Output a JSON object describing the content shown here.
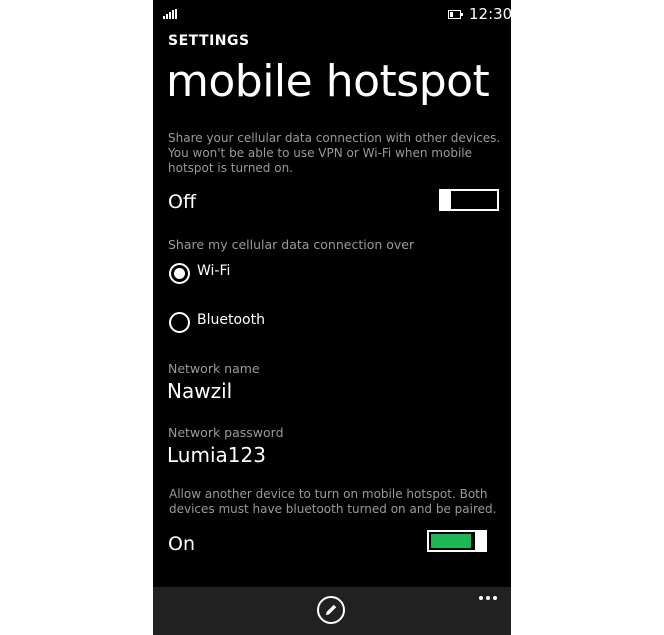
{
  "status_bar": {
    "time": "12:30",
    "signal_icon": "signal-icon",
    "battery_icon": "battery-icon"
  },
  "header": {
    "app_title": "SETTINGS",
    "page_title": "mobile hotspot"
  },
  "hotspot": {
    "description": "Share your cellular data connection with other devices. You won't be able to use VPN or Wi-Fi when mobile hotspot is turned on.",
    "toggle_label": "Off",
    "toggle_on": false
  },
  "share_over": {
    "label": "Share my cellular data connection over",
    "options": [
      {
        "label": "Wi-Fi",
        "selected": true
      },
      {
        "label": "Bluetooth",
        "selected": false
      }
    ]
  },
  "network": {
    "name_label": "Network name",
    "name_value": "Nawzil",
    "password_label": "Network password",
    "password_value": "Lumia123"
  },
  "remote": {
    "description": "Allow another device to turn on mobile hotspot. Both devices must have bluetooth turned on and be paired.",
    "toggle_label": "On",
    "toggle_on": true
  },
  "app_bar": {
    "edit_icon": "pencil-icon",
    "more_icon": "more-icon"
  },
  "colors": {
    "background": "#000000",
    "accent": "#1db954",
    "secondary_text": "#9a9a9a",
    "app_bar": "#212121"
  }
}
